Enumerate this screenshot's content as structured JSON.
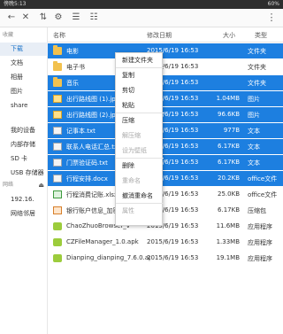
{
  "status_bar": {
    "time": "傍晚5:13",
    "battery": "60%"
  },
  "toolbar": {
    "icons": [
      "back-arrow-icon",
      "close-icon",
      "sort-icon",
      "settings-icon",
      "select-mode-icon",
      "more-vert-icon"
    ]
  },
  "sidebar": {
    "favorites_header": "收藏",
    "favorites": [
      {
        "label": "下载",
        "active": true
      },
      {
        "label": "文档",
        "active": false
      },
      {
        "label": "相册",
        "active": false
      },
      {
        "label": "图片",
        "active": false
      },
      {
        "label": "share",
        "active": false
      }
    ],
    "devices": [
      {
        "label": "我的设备"
      },
      {
        "label": "内部存储"
      },
      {
        "label": "SD 卡"
      },
      {
        "label": "USB 存储器"
      }
    ],
    "network_header": "网络",
    "network": [
      {
        "label": "192.16."
      },
      {
        "label": "网络邻居"
      }
    ]
  },
  "columns": {
    "name": "名称",
    "modified": "修改日期",
    "size": "大小",
    "type": "类型"
  },
  "files": [
    {
      "name": "电影",
      "date": "2015/6/19 16:53",
      "size": "",
      "type": "文件夹",
      "selected": true,
      "kind": "folder"
    },
    {
      "name": "电子书",
      "date": "2015/6/19 16:53",
      "size": "",
      "type": "文件夹",
      "selected": false,
      "kind": "folder"
    },
    {
      "name": "音乐",
      "date": "2015/6/19 16:53",
      "size": "",
      "type": "文件夹",
      "selected": true,
      "kind": "folder"
    },
    {
      "name": "出行路线图 (1).jpg",
      "date": "2015/6/19 16:53",
      "size": "1.04MB",
      "type": "图片",
      "selected": true,
      "kind": "img"
    },
    {
      "name": "出行路线图 (2).jpg",
      "date": "2015/6/19 16:53",
      "size": "96.6KB",
      "type": "图片",
      "selected": true,
      "kind": "img"
    },
    {
      "name": "记事本.txt",
      "date": "2015/6/19 16:53",
      "size": "977B",
      "type": "文本",
      "selected": true,
      "kind": "txt"
    },
    {
      "name": "联系人电话汇总.txt",
      "date": "2015/6/19 16:53",
      "size": "6.17KB",
      "type": "文本",
      "selected": true,
      "kind": "txt"
    },
    {
      "name": "门票验证码.txt",
      "date": "2015/6/19 16:53",
      "size": "6.17KB",
      "type": "文本",
      "selected": true,
      "kind": "txt"
    },
    {
      "name": "行程安排.docx",
      "date": "2015/6/19 16:53",
      "size": "20.2KB",
      "type": "office文件",
      "selected": true,
      "kind": "txt"
    },
    {
      "name": "行程消费记账.xlsx",
      "date": "2015/6/19 16:53",
      "size": "25.0KB",
      "type": "office文件",
      "selected": false,
      "kind": "xls"
    },
    {
      "name": "银行账户信息_加密",
      "date": "2015/6/19 16:53",
      "size": "6.17KB",
      "type": "压缩包",
      "selected": false,
      "kind": "zip"
    },
    {
      "name": "ChaoZhuoBrowser_v",
      "date": "2015/6/19 16:53",
      "size": "11.6MB",
      "type": "应用程序",
      "selected": false,
      "kind": "apk"
    },
    {
      "name": "CZFileManager_1.0.apk",
      "date": "2015/6/19 16:53",
      "size": "1.33MB",
      "type": "应用程序",
      "selected": false,
      "kind": "apk"
    },
    {
      "name": "Dianping_dianping_7.6.0.apk",
      "date": "2015/6/19 16:53",
      "size": "19.1MB",
      "type": "应用程序",
      "selected": false,
      "kind": "apk"
    }
  ],
  "context_menu": {
    "items": [
      {
        "label": "新建文件夹",
        "enabled": true
      },
      {
        "label": "复制",
        "enabled": true
      },
      {
        "label": "剪切",
        "enabled": true
      },
      {
        "label": "粘贴",
        "enabled": true
      },
      {
        "label": "压缩",
        "enabled": true
      },
      {
        "label": "解压缩",
        "enabled": false
      },
      {
        "label": "设为壁纸",
        "enabled": false
      },
      {
        "label": "删除",
        "enabled": true
      },
      {
        "label": "重命名",
        "enabled": false
      },
      {
        "label": "撤消重命名",
        "enabled": true
      },
      {
        "label": "属性",
        "enabled": false
      }
    ]
  },
  "colors": {
    "selection": "#1d7fe0",
    "sidebar_active": "#e8eef6",
    "folder": "#f2c14e"
  }
}
